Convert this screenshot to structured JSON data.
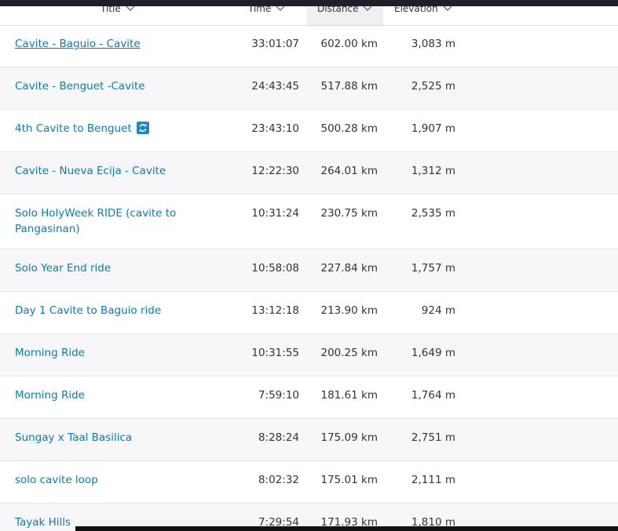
{
  "table": {
    "headers": {
      "title": "Title",
      "time": "Time",
      "distance": "Distance",
      "elevation": "Elevation"
    },
    "rows": [
      {
        "title": "Cavite - Baguio - Cavite",
        "time": "33:01:07",
        "distance": "602.00 km",
        "elevation": "3,083 m",
        "underlined": true,
        "sync_icon": false
      },
      {
        "title": "Cavite - Benguet -Cavite",
        "time": "24:43:45",
        "distance": "517.88 km",
        "elevation": "2,525 m",
        "underlined": false,
        "sync_icon": false
      },
      {
        "title": "4th Cavite to Benguet",
        "time": "23:43:10",
        "distance": "500.28 km",
        "elevation": "1,907 m",
        "underlined": false,
        "sync_icon": true
      },
      {
        "title": "Cavite - Nueva Ecija - Cavite",
        "time": "12:22:30",
        "distance": "264.01 km",
        "elevation": "1,312 m",
        "underlined": false,
        "sync_icon": false
      },
      {
        "title": "Solo HolyWeek RIDE (cavite to Pangasinan)",
        "time": "10:31:24",
        "distance": "230.75 km",
        "elevation": "2,535 m",
        "underlined": false,
        "sync_icon": false
      },
      {
        "title": "Solo Year End ride",
        "time": "10:58:08",
        "distance": "227.84 km",
        "elevation": "1,757 m",
        "underlined": false,
        "sync_icon": false
      },
      {
        "title": "Day 1 Cavite to Baguio ride",
        "time": "13:12:18",
        "distance": "213.90 km",
        "elevation": "924 m",
        "underlined": false,
        "sync_icon": false
      },
      {
        "title": "Morning Ride",
        "time": "10:31:55",
        "distance": "200.25 km",
        "elevation": "1,649 m",
        "underlined": false,
        "sync_icon": false
      },
      {
        "title": "Morning Ride",
        "time": "7:59:10",
        "distance": "181.61 km",
        "elevation": "1,764 m",
        "underlined": false,
        "sync_icon": false
      },
      {
        "title": "Sungay x Taal Basilica",
        "time": "8:28:24",
        "distance": "175.09 km",
        "elevation": "2,751 m",
        "underlined": false,
        "sync_icon": false
      },
      {
        "title": "solo cavite loop",
        "time": "8:02:32",
        "distance": "175.01 km",
        "elevation": "2,111 m",
        "underlined": false,
        "sync_icon": false
      },
      {
        "title": "Tayak Hills",
        "time": "7:29:54",
        "distance": "171.93 km",
        "elevation": "1,810 m",
        "underlined": false,
        "sync_icon": false
      }
    ]
  },
  "icons": {
    "sort": "chevron-down-icon",
    "sync": "sync-icon"
  },
  "colors": {
    "link": "#007fb6",
    "text": "#333333",
    "row_alt": "#f7f7fa",
    "header_active": "#f0f0f2",
    "sync_icon_bg": "#1f88c9"
  }
}
